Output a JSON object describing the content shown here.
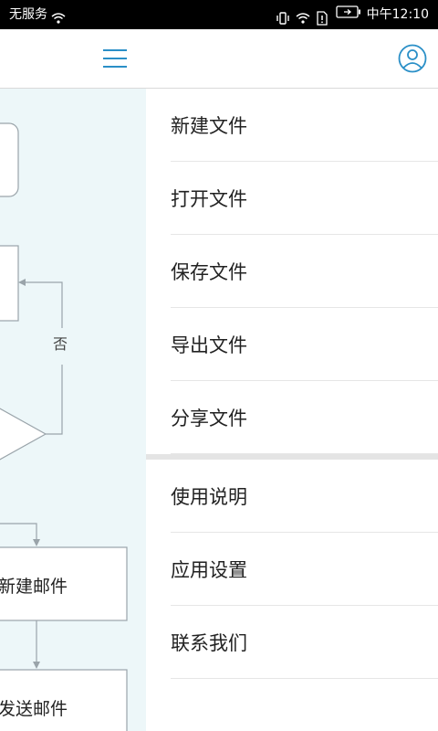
{
  "status_bar": {
    "carrier": "无服务",
    "time": "中午12:10"
  },
  "app_bar": {
    "menu_icon": "hamburger-menu-icon",
    "account_icon": "account-circle-icon"
  },
  "flowchart": {
    "decision_no_label": "否",
    "node_new_mail": "新建邮件",
    "node_send_mail": "发送邮件"
  },
  "drawer": {
    "file_items": [
      {
        "label": "新建文件"
      },
      {
        "label": "打开文件"
      },
      {
        "label": "保存文件"
      },
      {
        "label": "导出文件"
      },
      {
        "label": "分享文件"
      }
    ],
    "app_items": [
      {
        "label": "使用说明"
      },
      {
        "label": "应用设置"
      },
      {
        "label": "联系我们"
      }
    ]
  },
  "colors": {
    "accent": "#2a8fc7",
    "canvas_bg": "#edf7f9",
    "flow_stroke": "#9aa4aa"
  }
}
